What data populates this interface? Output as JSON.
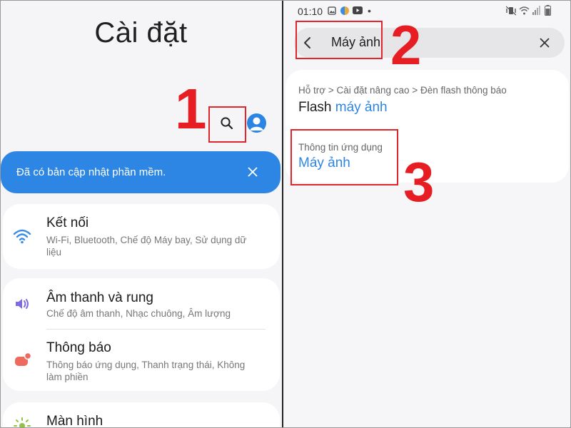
{
  "left": {
    "title": "Cài đặt",
    "annotation": "1",
    "search_icon": "search-icon",
    "avatar_icon": "account-icon",
    "update_banner": {
      "text": "Đã có bản cập nhật phần mềm.",
      "close_icon": "close-icon"
    },
    "items": [
      {
        "icon": "wifi-icon",
        "title": "Kết nối",
        "subtitle": "Wi-Fi, Bluetooth, Chế độ Máy bay, Sử dụng dữ liệu"
      },
      {
        "icon": "volume-icon",
        "title": "Âm thanh và rung",
        "subtitle": "Chế độ âm thanh, Nhạc chuông, Âm lượng"
      },
      {
        "icon": "notification-icon",
        "title": "Thông báo",
        "subtitle": "Thông báo ứng dụng, Thanh trạng thái, Không làm phiền"
      },
      {
        "icon": "display-icon",
        "title": "Màn hình",
        "subtitle": ""
      }
    ],
    "colors": {
      "accent": "#2e86e4",
      "annotation": "#e61e24"
    }
  },
  "right": {
    "status_bar": {
      "time": "01:10",
      "dot": "•"
    },
    "search": {
      "query": "Máy ảnh",
      "back_icon": "back-arrow-icon",
      "clear_icon": "close-icon"
    },
    "annotations": [
      "2",
      "3"
    ],
    "results": [
      {
        "path": "Hỗ trợ > Cài đặt nâng cao > Đèn flash thông báo",
        "title_prefix": "Flash ",
        "title_match": "máy ảnh"
      },
      {
        "path": "Thông tin ứng dụng",
        "title_match": "Máy ảnh"
      }
    ]
  }
}
